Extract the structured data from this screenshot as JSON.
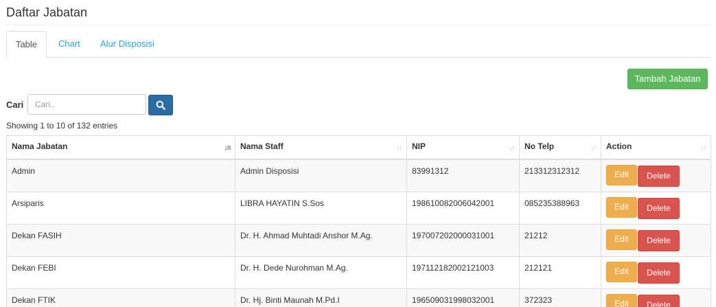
{
  "page": {
    "title": "Daftar Jabatan"
  },
  "tabs": [
    {
      "label": "Table",
      "active": true
    },
    {
      "label": "Chart",
      "active": false
    },
    {
      "label": "Alur Disposisi",
      "active": false
    }
  ],
  "toolbar": {
    "add_label": "Tambah Jabatan"
  },
  "search": {
    "label": "Cari",
    "placeholder": "Cari..",
    "value": ""
  },
  "info": {
    "showing": "Showing 1 to 10 of 132 entries"
  },
  "table": {
    "columns": [
      "Nama Jabatan",
      "Nama Staff",
      "NIP",
      "No Telp",
      "Action"
    ],
    "rows": [
      {
        "jabatan": "Admin",
        "staff": "Admin Disposisi",
        "nip": "83991312",
        "telp": "213312312312"
      },
      {
        "jabatan": "Arsiparis",
        "staff": "LIBRA HAYATIN S.Sos",
        "nip": "198610082006042001",
        "telp": "085235388963"
      },
      {
        "jabatan": "Dekan FASIH",
        "staff": "Dr. H. Ahmad Muhtadi Anshor M.Ag.",
        "nip": "197007202000031001",
        "telp": "21212"
      },
      {
        "jabatan": "Dekan FEBI",
        "staff": "Dr. H. Dede Nurohman M.Ag.",
        "nip": "197112182002121003",
        "telp": "212121"
      },
      {
        "jabatan": "Dekan FTIK",
        "staff": "Dr. Hj. Binti Maunah M.Pd.I",
        "nip": "196509031998032001",
        "telp": "372323"
      }
    ],
    "edit_label": "Edit",
    "delete_label": "Delete"
  },
  "colors": {
    "primary": "#2a6ca5",
    "success": "#5cb85c",
    "warning": "#f0ad4e",
    "danger": "#d9534f",
    "link": "#23a5d4"
  }
}
